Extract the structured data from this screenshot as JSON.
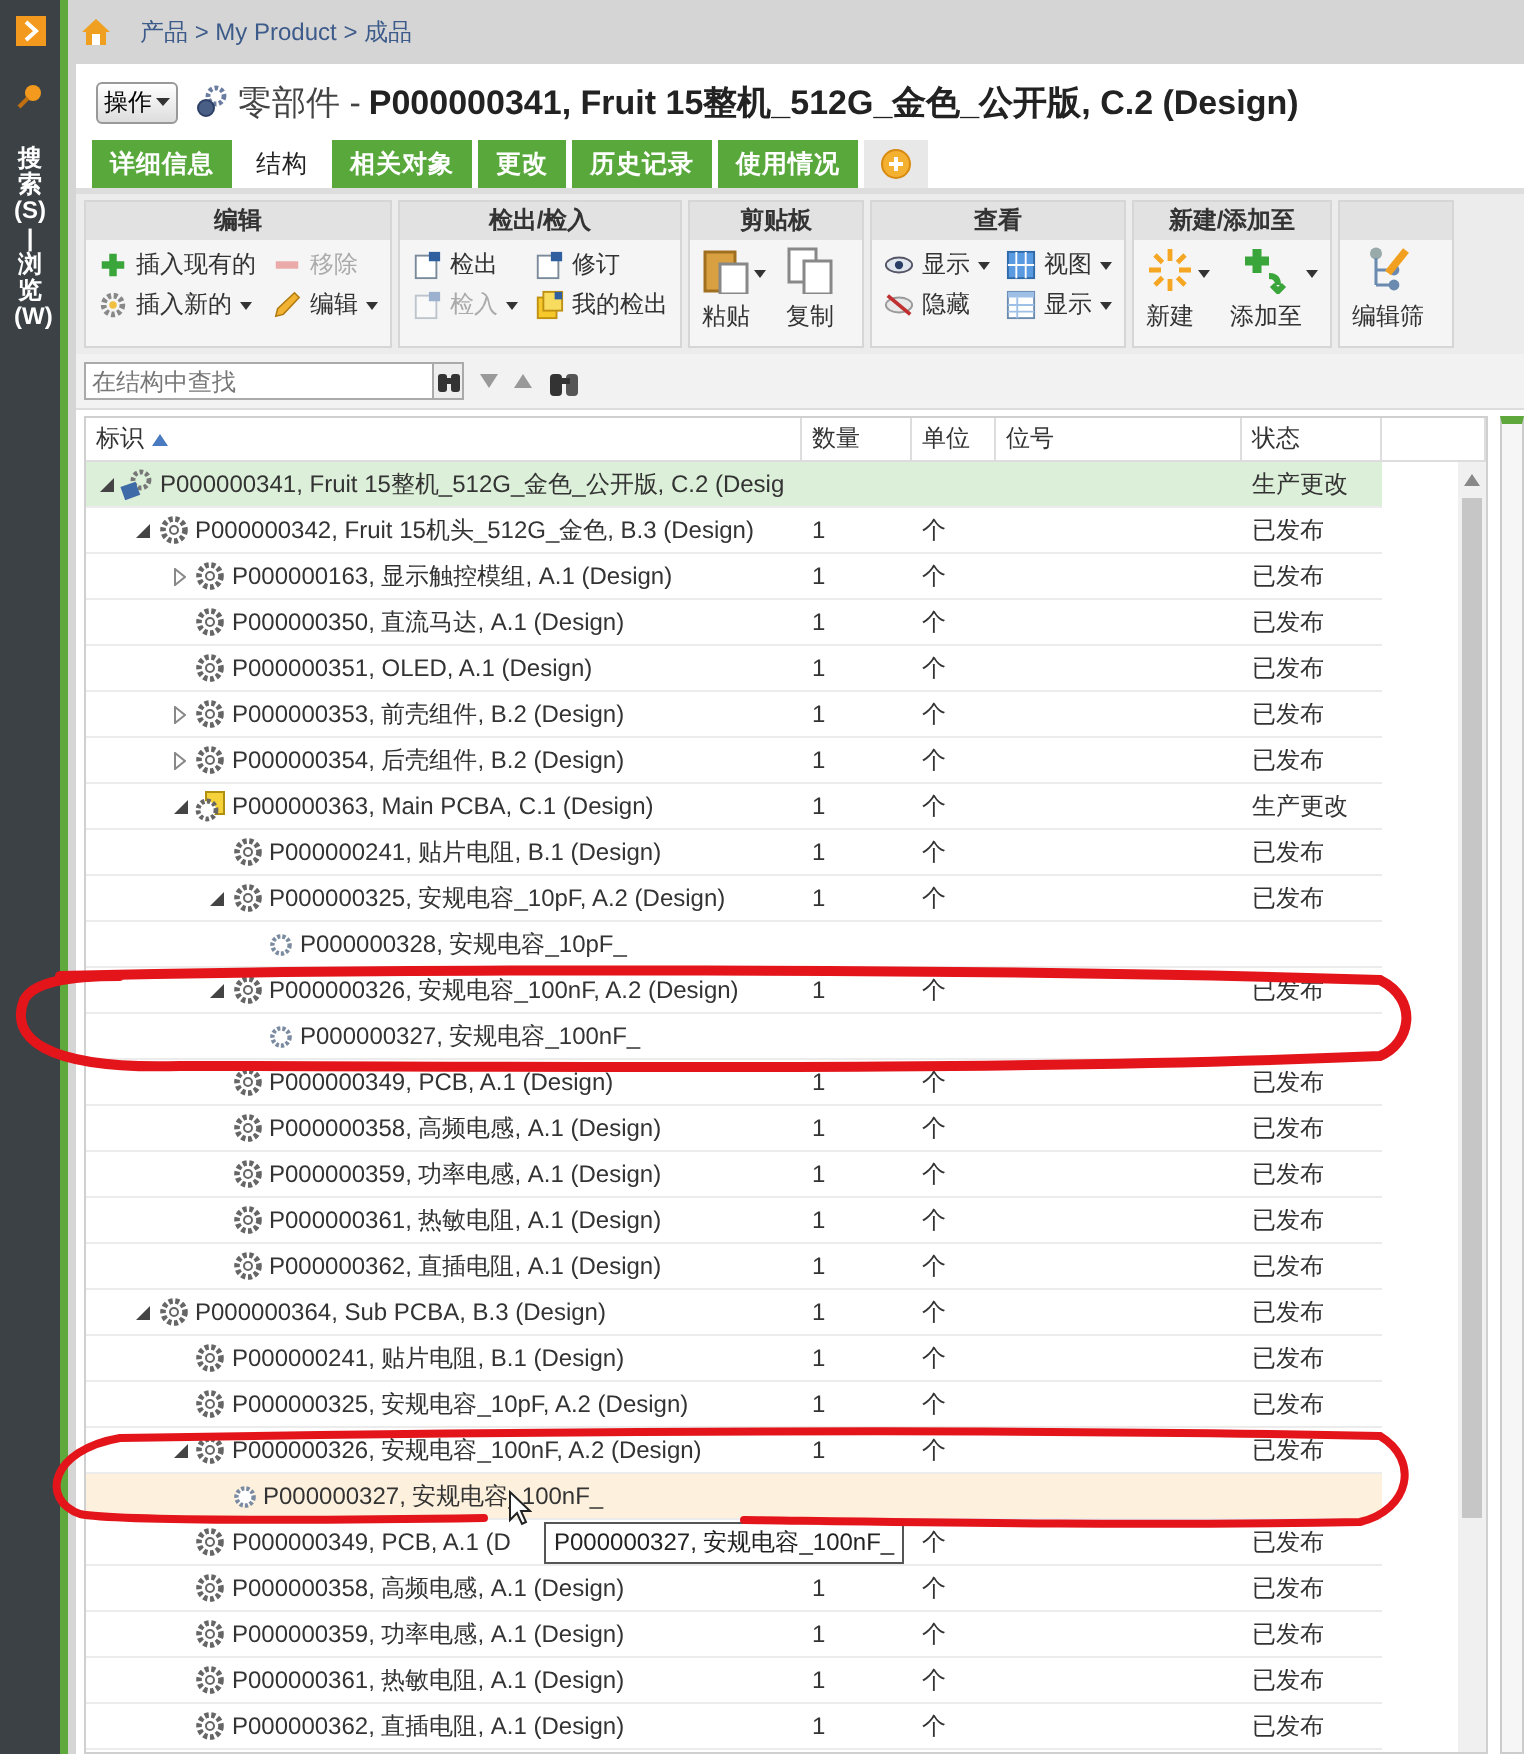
{
  "sidebar": {
    "label": "搜索(S) | 浏览(W)"
  },
  "breadcrumb": "产品 > My Product > 成品",
  "header": {
    "actions_button": "操作",
    "title_prefix": "零部件 -",
    "title": "P000000341, Fruit 15整机_512G_金色_公开版, C.2 (Design)"
  },
  "tabs": [
    {
      "label": "详细信息",
      "selected": false
    },
    {
      "label": "结构",
      "selected": true
    },
    {
      "label": "相关对象",
      "selected": false
    },
    {
      "label": "更改",
      "selected": false
    },
    {
      "label": "历史记录",
      "selected": false
    },
    {
      "label": "使用情况",
      "selected": false
    }
  ],
  "toolbar": [
    {
      "title": "编辑",
      "items": [
        {
          "label": "插入现有的",
          "kind": "small",
          "disabled": false,
          "dropdown": false
        },
        {
          "label": "移除",
          "kind": "small",
          "disabled": true,
          "dropdown": false
        },
        {
          "label": "插入新的",
          "kind": "small",
          "disabled": false,
          "dropdown": true
        },
        {
          "label": "编辑",
          "kind": "small",
          "disabled": false,
          "dropdown": true
        }
      ]
    },
    {
      "title": "检出/检入",
      "items": [
        {
          "label": "检出",
          "kind": "small",
          "disabled": false,
          "dropdown": false
        },
        {
          "label": "修订",
          "kind": "small",
          "disabled": false,
          "dropdown": false
        },
        {
          "label": "检入",
          "kind": "small",
          "disabled": true,
          "dropdown": true
        },
        {
          "label": "我的检出",
          "kind": "small",
          "disabled": false,
          "dropdown": false
        }
      ]
    },
    {
      "title": "剪贴板",
      "items": [
        {
          "label": "粘贴",
          "kind": "large",
          "disabled": false,
          "dropdown": true
        },
        {
          "label": "复制",
          "kind": "large",
          "disabled": false,
          "dropdown": false
        }
      ]
    },
    {
      "title": "查看",
      "items": [
        {
          "label": "显示",
          "kind": "small",
          "disabled": false,
          "dropdown": true
        },
        {
          "label": "视图",
          "kind": "small",
          "disabled": false,
          "dropdown": true
        },
        {
          "label": "隐藏",
          "kind": "small",
          "disabled": false,
          "dropdown": false
        },
        {
          "label": "显示",
          "kind": "small",
          "disabled": false,
          "dropdown": true
        }
      ]
    },
    {
      "title": "新建/添加至",
      "items": [
        {
          "label": "新建",
          "kind": "large",
          "disabled": false,
          "dropdown": true
        },
        {
          "label": "添加至",
          "kind": "large",
          "disabled": false,
          "dropdown": true
        }
      ]
    },
    {
      "items": [
        {
          "label": "编辑筛",
          "kind": "large",
          "disabled": false,
          "dropdown": false
        }
      ]
    }
  ],
  "search": {
    "placeholder": "在结构中查找"
  },
  "table": {
    "columns": [
      {
        "label": "标识",
        "sorted": true
      },
      {
        "label": "数量",
        "sorted": false
      },
      {
        "label": "单位",
        "sorted": false
      },
      {
        "label": "位号",
        "sorted": false
      },
      {
        "label": "状态",
        "sorted": false
      }
    ],
    "rows": [
      {
        "label": "P000000341, Fruit 15整机_512G_金色_公开版, C.2 (Desig",
        "status": "生产更改",
        "kind": "assembly",
        "expanded": true,
        "selected": true,
        "hovered": false,
        "children": [
          {
            "label": "P000000342, Fruit 15机头_512G_金色, B.3 (Design)",
            "qty": "1",
            "unit": "个",
            "status": "已发布",
            "kind": "part",
            "expanded": true,
            "selected": false,
            "hovered": false,
            "children": [
              {
                "label": "P000000163, 显示触控模组, A.1 (Design)",
                "qty": "1",
                "unit": "个",
                "status": "已发布",
                "kind": "part",
                "expanded": false,
                "selected": false,
                "hovered": false
              },
              {
                "label": "P000000350, 直流马达, A.1 (Design)",
                "qty": "1",
                "unit": "个",
                "status": "已发布",
                "kind": "part",
                "selected": false,
                "hovered": false
              },
              {
                "label": "P000000351, OLED, A.1 (Design)",
                "qty": "1",
                "unit": "个",
                "status": "已发布",
                "kind": "part",
                "selected": false,
                "hovered": false
              },
              {
                "label": "P000000353, 前壳组件, B.2 (Design)",
                "qty": "1",
                "unit": "个",
                "status": "已发布",
                "kind": "part",
                "expanded": false,
                "selected": false,
                "hovered": false
              },
              {
                "label": "P000000354, 后壳组件, B.2 (Design)",
                "qty": "1",
                "unit": "个",
                "status": "已发布",
                "kind": "part",
                "expanded": false,
                "selected": false,
                "hovered": false
              },
              {
                "label": "P000000363, Main PCBA, C.1 (Design)",
                "qty": "1",
                "unit": "个",
                "status": "生产更改",
                "kind": "modified",
                "expanded": true,
                "selected": false,
                "hovered": false,
                "children": [
                  {
                    "label": "P000000241, 贴片电阻, B.1 (Design)",
                    "qty": "1",
                    "unit": "个",
                    "status": "已发布",
                    "kind": "part",
                    "selected": false,
                    "hovered": false
                  },
                  {
                    "label": "P000000325, 安规电容_10pF, A.2 (Design)",
                    "qty": "1",
                    "unit": "个",
                    "status": "已发布",
                    "kind": "part",
                    "expanded": true,
                    "selected": false,
                    "hovered": false,
                    "children": [
                      {
                        "label": "P000000328, 安规电容_10pF_",
                        "kind": "reference",
                        "selected": false,
                        "hovered": false
                      }
                    ]
                  },
                  {
                    "label": "P000000326, 安规电容_100nF, A.2 (Design)",
                    "qty": "1",
                    "unit": "个",
                    "status": "已发布",
                    "kind": "part",
                    "expanded": true,
                    "selected": false,
                    "hovered": false,
                    "children": [
                      {
                        "label": "P000000327, 安规电容_100nF_",
                        "kind": "reference",
                        "selected": false,
                        "hovered": false
                      }
                    ]
                  },
                  {
                    "label": "P000000349, PCB, A.1 (Design)",
                    "qty": "1",
                    "unit": "个",
                    "status": "已发布",
                    "kind": "part",
                    "selected": false,
                    "hovered": false
                  },
                  {
                    "label": "P000000358, 高频电感, A.1 (Design)",
                    "qty": "1",
                    "unit": "个",
                    "status": "已发布",
                    "kind": "part",
                    "selected": false,
                    "hovered": false
                  },
                  {
                    "label": "P000000359, 功率电感, A.1 (Design)",
                    "qty": "1",
                    "unit": "个",
                    "status": "已发布",
                    "kind": "part",
                    "selected": false,
                    "hovered": false
                  },
                  {
                    "label": "P000000361, 热敏电阻, A.1 (Design)",
                    "qty": "1",
                    "unit": "个",
                    "status": "已发布",
                    "kind": "part",
                    "selected": false,
                    "hovered": false
                  },
                  {
                    "label": "P000000362, 直插电阻, A.1 (Design)",
                    "qty": "1",
                    "unit": "个",
                    "status": "已发布",
                    "kind": "part",
                    "selected": false,
                    "hovered": false
                  }
                ]
              }
            ]
          },
          {
            "label": "P000000364, Sub PCBA, B.3 (Design)",
            "qty": "1",
            "unit": "个",
            "status": "已发布",
            "kind": "part",
            "expanded": true,
            "selected": false,
            "hovered": false,
            "children": [
              {
                "label": "P000000241, 贴片电阻, B.1 (Design)",
                "qty": "1",
                "unit": "个",
                "status": "已发布",
                "kind": "part",
                "selected": false,
                "hovered": false
              },
              {
                "label": "P000000325, 安规电容_10pF, A.2 (Design)",
                "qty": "1",
                "unit": "个",
                "status": "已发布",
                "kind": "part",
                "selected": false,
                "hovered": false
              },
              {
                "label": "P000000326, 安规电容_100nF, A.2 (Design)",
                "qty": "1",
                "unit": "个",
                "status": "已发布",
                "kind": "part",
                "expanded": true,
                "selected": false,
                "hovered": false,
                "children": [
                  {
                    "label": "P000000327, 安规电容_100nF_",
                    "kind": "reference",
                    "selected": false,
                    "hovered": true
                  }
                ]
              },
              {
                "label": "P000000349, PCB, A.1 (D",
                "unit": "个",
                "status": "已发布",
                "kind": "part",
                "selected": false,
                "hovered": false
              },
              {
                "label": "P000000358, 高频电感, A.1 (Design)",
                "qty": "1",
                "unit": "个",
                "status": "已发布",
                "kind": "part",
                "selected": false,
                "hovered": false
              },
              {
                "label": "P000000359, 功率电感, A.1 (Design)",
                "qty": "1",
                "unit": "个",
                "status": "已发布",
                "kind": "part",
                "selected": false,
                "hovered": false
              },
              {
                "label": "P000000361, 热敏电阻, A.1 (Design)",
                "qty": "1",
                "unit": "个",
                "status": "已发布",
                "kind": "part",
                "selected": false,
                "hovered": false
              },
              {
                "label": "P000000362, 直插电阻, A.1 (Design)",
                "qty": "1",
                "unit": "个",
                "status": "已发布",
                "kind": "part",
                "selected": false,
                "hovered": false
              }
            ]
          }
        ]
      }
    ]
  },
  "tooltip": {
    "text": "P000000327, 安规电容_100nF_"
  }
}
